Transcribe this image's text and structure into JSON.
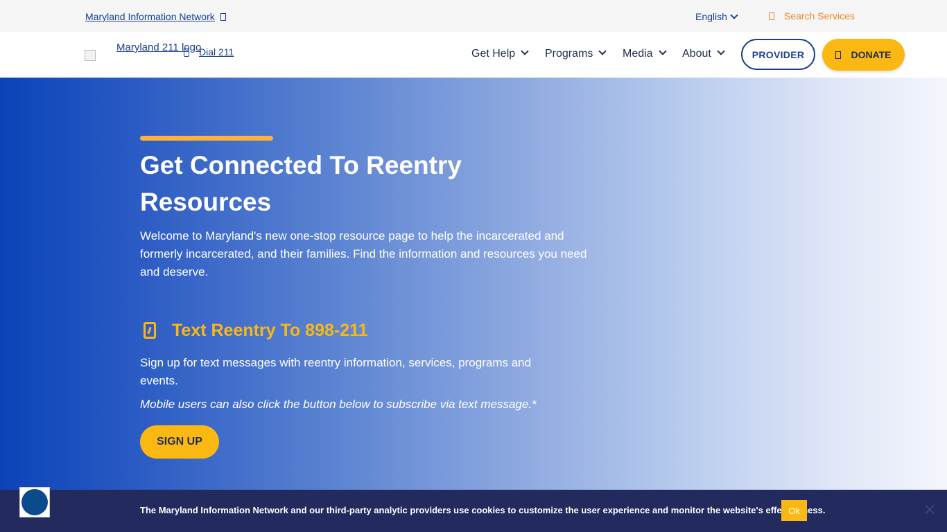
{
  "topbar": {
    "network_link": "Maryland Information Network",
    "language": "English",
    "search": "Search Services"
  },
  "nav": {
    "logo_alt": "Maryland 211 logo",
    "dial": "Dial 211",
    "menu": [
      {
        "label": "Get Help"
      },
      {
        "label": "Programs"
      },
      {
        "label": "Media"
      },
      {
        "label": "About"
      }
    ],
    "provider": "PROVIDER",
    "donate": "DONATE"
  },
  "hero": {
    "title": "Get Connected To Reentry Resources",
    "intro": "Welcome to Maryland's new one-stop resource page to help the incarcerated and formerly incarcerated, and their families. Find the information and resources you need and deserve.",
    "text_cta": "Text Reentry To 898-211",
    "signup_text": "Sign up for text messages with reentry information, services, programs and events.",
    "mobile_note": "Mobile users can also click the button below to subscribe via text message.*",
    "signup_button": "SIGN UP"
  },
  "cookie": {
    "message": "The Maryland Information Network and our third-party analytic providers use cookies to customize the user experience and monitor the website's effectiveness.",
    "ok": "Ok"
  },
  "colors": {
    "brand_blue": "#1a3f8f",
    "accent_yellow": "#fcb812",
    "cookie_bg": "#222a5e"
  }
}
